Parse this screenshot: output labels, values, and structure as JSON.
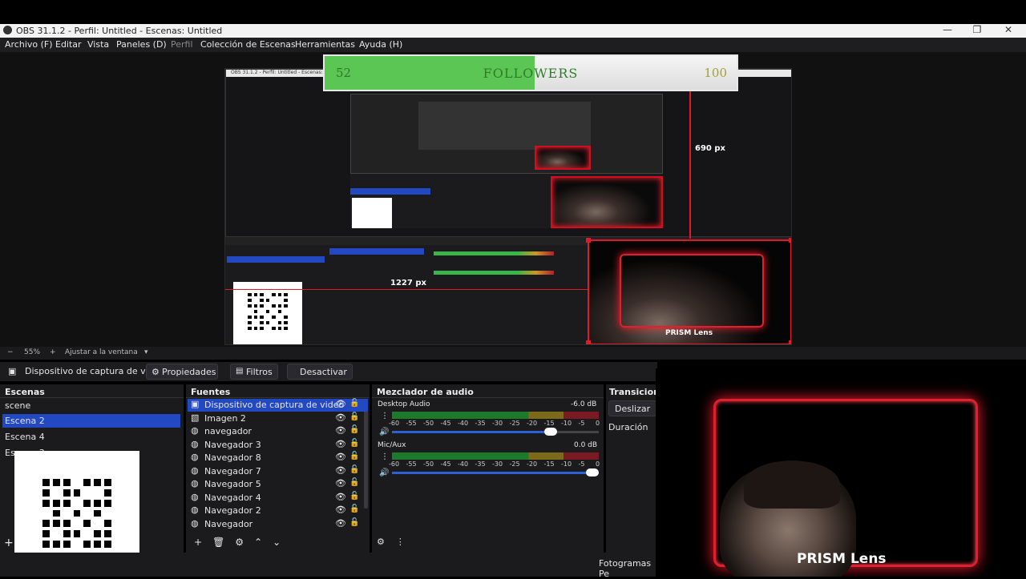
{
  "window": {
    "title": "OBS 31.1.2 - Perfil: Untitled - Escenas: Untitled",
    "controls": [
      "—",
      "❐",
      "✕"
    ]
  },
  "menu": [
    "Archivo (F)",
    "Editar",
    "Vista",
    "Paneles (D)",
    "Perfil",
    "Colección de Escenas",
    "Herramientas",
    "Ayuda (H)"
  ],
  "preview": {
    "followers": {
      "current": "52",
      "label": "FOLLOWERS",
      "goal": "100",
      "progress": 0.52
    },
    "measure_vertical": "690 px",
    "measure_horizontal": "1227 px",
    "webcam_label": "PRISM Lens",
    "nested_title": "OBS 31.1.2 - Perfil: Untitled - Escenas: Untitled"
  },
  "zoom": {
    "minus": "−",
    "value": "55%",
    "plus": "+",
    "fit": "Ajustar a la ventana"
  },
  "source_bar": {
    "source_name": "Dispositivo de captura de v",
    "properties": "Propiedades",
    "filters": "Filtros",
    "deactivate": "Desactivar"
  },
  "scenes": {
    "title": "Escenas",
    "items": [
      "scene",
      "Escena 2",
      "Escena 4",
      "Escena 3"
    ],
    "selected": 1
  },
  "sources": {
    "title": "Fuentes",
    "items": [
      {
        "name": "Dispositivo de captura de video",
        "icon": "camera-icon"
      },
      {
        "name": "Imagen 2",
        "icon": "image-icon"
      },
      {
        "name": "navegador",
        "icon": "globe-icon"
      },
      {
        "name": "Navegador 3",
        "icon": "globe-icon"
      },
      {
        "name": "Navegador 8",
        "icon": "globe-icon"
      },
      {
        "name": "Navegador 7",
        "icon": "globe-icon"
      },
      {
        "name": "Navegador 5",
        "icon": "globe-icon"
      },
      {
        "name": "Navegador 4",
        "icon": "globe-icon"
      },
      {
        "name": "Navegador 2",
        "icon": "globe-icon"
      },
      {
        "name": "Navegador",
        "icon": "globe-icon"
      }
    ]
  },
  "mixer": {
    "title": "Mezclador de audio",
    "channels": [
      {
        "name": "Desktop Audio",
        "db": "-6.0 dB",
        "volume": 0.8
      },
      {
        "name": "Mic/Aux",
        "db": "0.0 dB",
        "volume": 1.0
      }
    ],
    "scale": [
      "-60",
      "-55",
      "-50",
      "-45",
      "-40",
      "-35",
      "-30",
      "-25",
      "-20",
      "-15",
      "-10",
      "-5",
      "0"
    ]
  },
  "transitions": {
    "title": "Transiciones",
    "type": "Deslizar",
    "duration_label": "Duración"
  },
  "footer": {
    "fps": "Fotogramas Pe"
  },
  "webcam": {
    "label": "PRISM Lens"
  },
  "colors": {
    "accent": "#2248c2",
    "frame_red": "#e0202e",
    "progress_green": "#5bc653"
  }
}
